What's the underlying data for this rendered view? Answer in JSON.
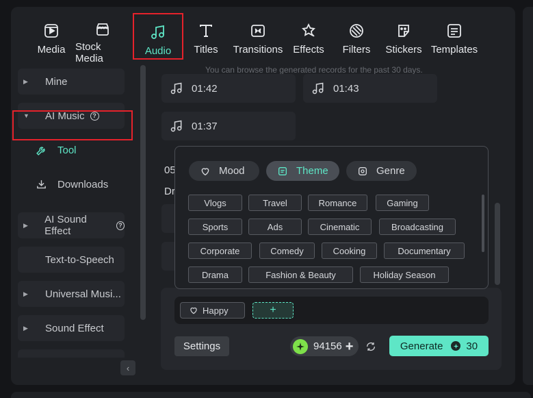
{
  "tabs": [
    {
      "label": "Media",
      "icon": "media-icon"
    },
    {
      "label": "Stock Media",
      "icon": "stock-media-icon"
    },
    {
      "label": "Audio",
      "icon": "audio-icon",
      "active": true
    },
    {
      "label": "Titles",
      "icon": "titles-icon"
    },
    {
      "label": "Transitions",
      "icon": "transitions-icon"
    },
    {
      "label": "Effects",
      "icon": "effects-icon"
    },
    {
      "label": "Filters",
      "icon": "filters-icon"
    },
    {
      "label": "Stickers",
      "icon": "stickers-icon"
    },
    {
      "label": "Templates",
      "icon": "templates-icon"
    }
  ],
  "sidebar": {
    "items": [
      {
        "label": "Mine"
      },
      {
        "label": "AI Music",
        "help": "?"
      },
      {
        "label": "Tool"
      },
      {
        "label": "Downloads"
      },
      {
        "label": "AI Sound Effect",
        "help": "?"
      },
      {
        "label": "Text-to-Speech"
      },
      {
        "label": "Universal Musi..."
      },
      {
        "label": "Sound Effect"
      }
    ],
    "collapse_glyph": "‹"
  },
  "main": {
    "notice": "You can browse the generated records for the past 30 days.",
    "records": [
      "01:42",
      "01:43",
      "01:37"
    ],
    "partial_date": "05",
    "partial_title": "Dr"
  },
  "popup": {
    "categories": [
      {
        "label": "Mood",
        "icon": "mood-icon"
      },
      {
        "label": "Theme",
        "icon": "theme-icon",
        "active": true
      },
      {
        "label": "Genre",
        "icon": "genre-icon"
      }
    ],
    "chips": [
      "Vlogs",
      "Travel",
      "Romance",
      "Gaming",
      "Sports",
      "Ads",
      "Cinematic",
      "Broadcasting",
      "Corporate",
      "Comedy",
      "Cooking",
      "Documentary",
      "Drama",
      "Fashion & Beauty",
      "Holiday Season"
    ]
  },
  "composer": {
    "tag": "Happy",
    "add_label": "+",
    "settings_label": "Settings",
    "credits": "94156",
    "credits_plus": "+",
    "generate_label": "Generate",
    "generate_cost": "30"
  },
  "colors": {
    "accent": "#5ee6c6",
    "highlight_border": "#e5222b",
    "panel": "#1f2125",
    "card": "#26282d"
  }
}
